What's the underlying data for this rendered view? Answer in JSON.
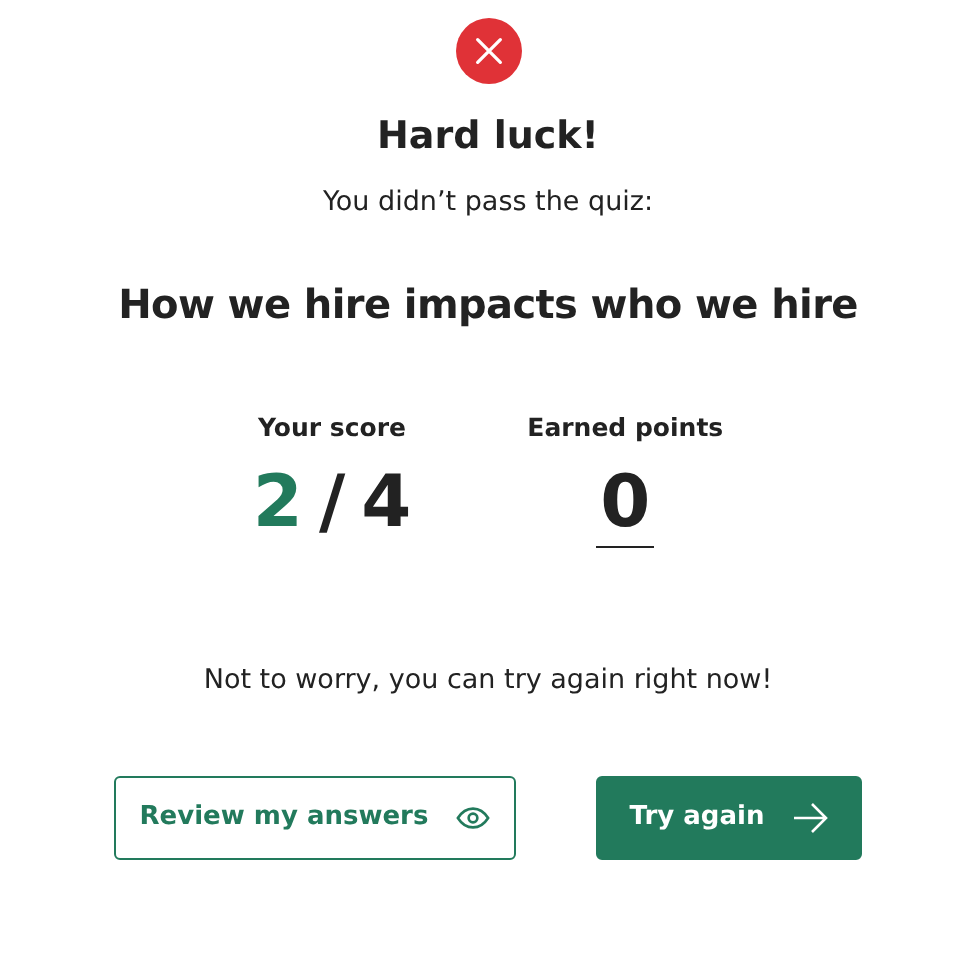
{
  "heading": "Hard luck!",
  "subtitle": "You didn’t pass the quiz:",
  "quiz_title": "How we hire impacts who we hire",
  "score": {
    "label": "Your score",
    "correct": "2",
    "separator": "/",
    "total": "4"
  },
  "points": {
    "label": "Earned points",
    "value": "0"
  },
  "message": "Not to worry, you can try again right now!",
  "buttons": [
    {
      "label": "Review my answers",
      "kind": "outline"
    },
    {
      "label": "Try again",
      "kind": "primary"
    }
  ]
}
